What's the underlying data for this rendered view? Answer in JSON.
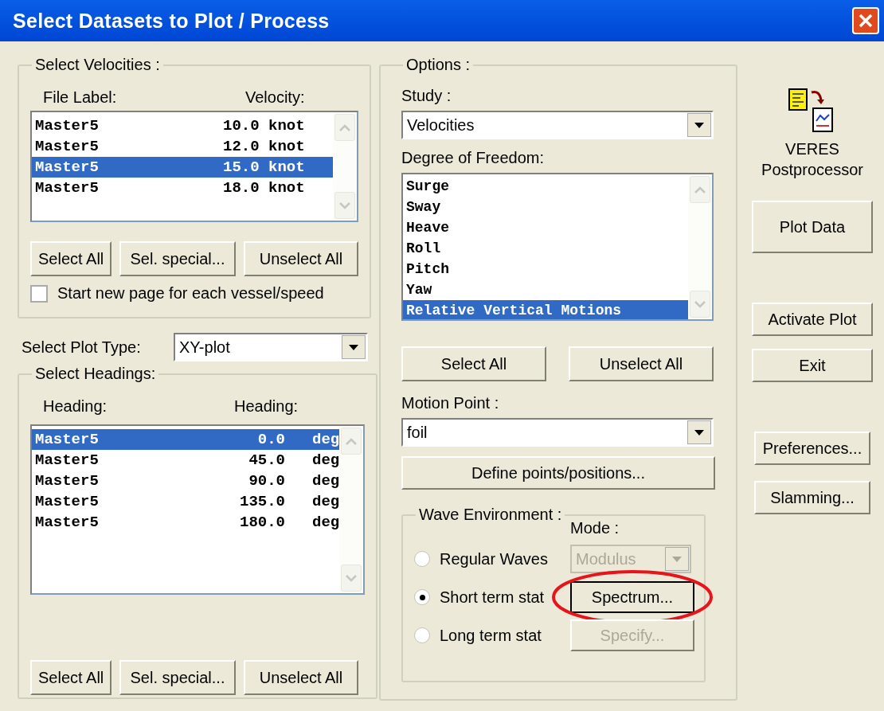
{
  "window": {
    "title": "Select Datasets to Plot / Process"
  },
  "velocities": {
    "legend": "Select Velocities :",
    "columns": [
      "File Label:",
      "Velocity:"
    ],
    "rows": [
      {
        "label": "Master5",
        "value": "10.0 knot",
        "selected": false
      },
      {
        "label": "Master5",
        "value": "12.0 knot",
        "selected": false
      },
      {
        "label": "Master5",
        "value": "15.0 knot",
        "selected": true
      },
      {
        "label": "Master5",
        "value": "18.0 knot",
        "selected": false
      }
    ],
    "buttons": [
      "Select All",
      "Sel. special...",
      "Unselect All"
    ],
    "new_page_option": {
      "label": "Start new page for each vessel/speed",
      "checked": false
    }
  },
  "plot_type": {
    "label": "Select Plot Type:",
    "value": "XY-plot"
  },
  "headings": {
    "legend": "Select Headings:",
    "columns": [
      "Heading:",
      "Heading:"
    ],
    "rows": [
      {
        "label": "Master5",
        "value": "0.0",
        "unit": "deg",
        "selected": true
      },
      {
        "label": "Master5",
        "value": "45.0",
        "unit": "deg",
        "selected": false
      },
      {
        "label": "Master5",
        "value": "90.0",
        "unit": "deg",
        "selected": false
      },
      {
        "label": "Master5",
        "value": "135.0",
        "unit": "deg",
        "selected": false
      },
      {
        "label": "Master5",
        "value": "180.0",
        "unit": "deg",
        "selected": false
      }
    ],
    "buttons": [
      "Select All",
      "Sel. special...",
      "Unselect All"
    ]
  },
  "options": {
    "legend": "Options :",
    "study": {
      "label": "Study :",
      "value": "Velocities"
    },
    "dof": {
      "label": "Degree of Freedom:",
      "items": [
        {
          "label": "Surge",
          "selected": false
        },
        {
          "label": "Sway",
          "selected": false
        },
        {
          "label": "Heave",
          "selected": false
        },
        {
          "label": "Roll",
          "selected": false
        },
        {
          "label": "Pitch",
          "selected": false
        },
        {
          "label": "Yaw",
          "selected": false
        },
        {
          "label": "Relative Vertical Motions",
          "selected": true
        }
      ]
    },
    "dof_buttons": [
      "Select All",
      "Unselect All"
    ],
    "motion_point": {
      "label": "Motion Point :",
      "value": "foil"
    },
    "define_button": "Define points/positions...",
    "wave": {
      "legend": "Wave Environment :",
      "mode_label": "Mode :",
      "options": [
        {
          "label": "Regular Waves",
          "selected": false,
          "control": {
            "kind": "dropdown",
            "value": "Modulus",
            "disabled": true,
            "highlighted": false
          }
        },
        {
          "label": "Short term stat",
          "selected": true,
          "control": {
            "kind": "button",
            "label": "Spectrum...",
            "disabled": false,
            "highlighted": true
          }
        },
        {
          "label": "Long term stat",
          "selected": false,
          "control": {
            "kind": "button",
            "label": "Specify...",
            "disabled": true,
            "highlighted": false
          }
        }
      ]
    }
  },
  "app": {
    "name": "VERES Postprocessor"
  },
  "side_buttons": [
    [
      "Plot Data"
    ],
    [
      "Activate Plot",
      "Exit"
    ],
    [
      "Preferences...",
      "Slamming..."
    ]
  ]
}
